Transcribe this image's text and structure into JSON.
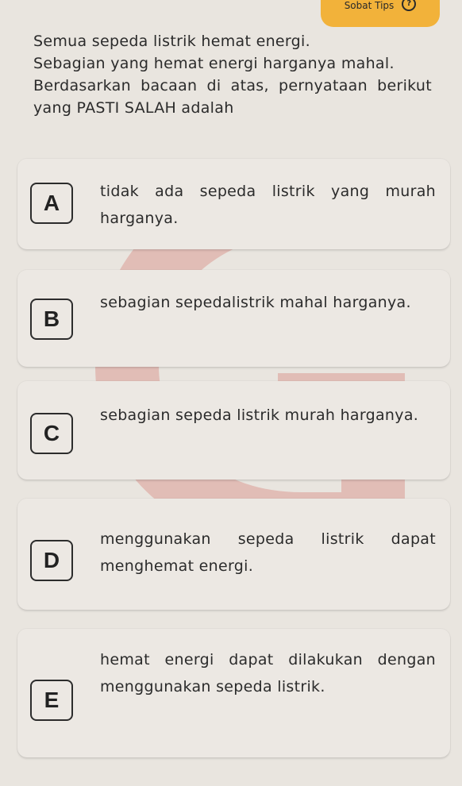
{
  "header": {
    "tips_label": "Sobat Tips",
    "help_icon": "question-circle-icon"
  },
  "question": {
    "line1": "Semua sepeda listrik hemat energi.",
    "line2": "Sebagian yang hemat energi harganya mahal.",
    "line3": "Berdasarkan bacaan di atas, pernyataan berikut yang PASTI SALAH adalah"
  },
  "options": [
    {
      "letter": "A",
      "text": "tidak ada sepeda listrik yang murah harganya."
    },
    {
      "letter": "B",
      "text": "sebagian sepedalistrik mahal harganya."
    },
    {
      "letter": "C",
      "text": "sebagian sepeda listrik murah harganya."
    },
    {
      "letter": "D",
      "text": "menggunakan sepeda listrik dapat menghemat energi."
    },
    {
      "letter": "E",
      "text": "hemat energi dapat dilakukan dengan menggunakan sepeda listrik."
    }
  ],
  "colors": {
    "tips_accent": "#f2b23a",
    "watermark": "#c9322a"
  }
}
